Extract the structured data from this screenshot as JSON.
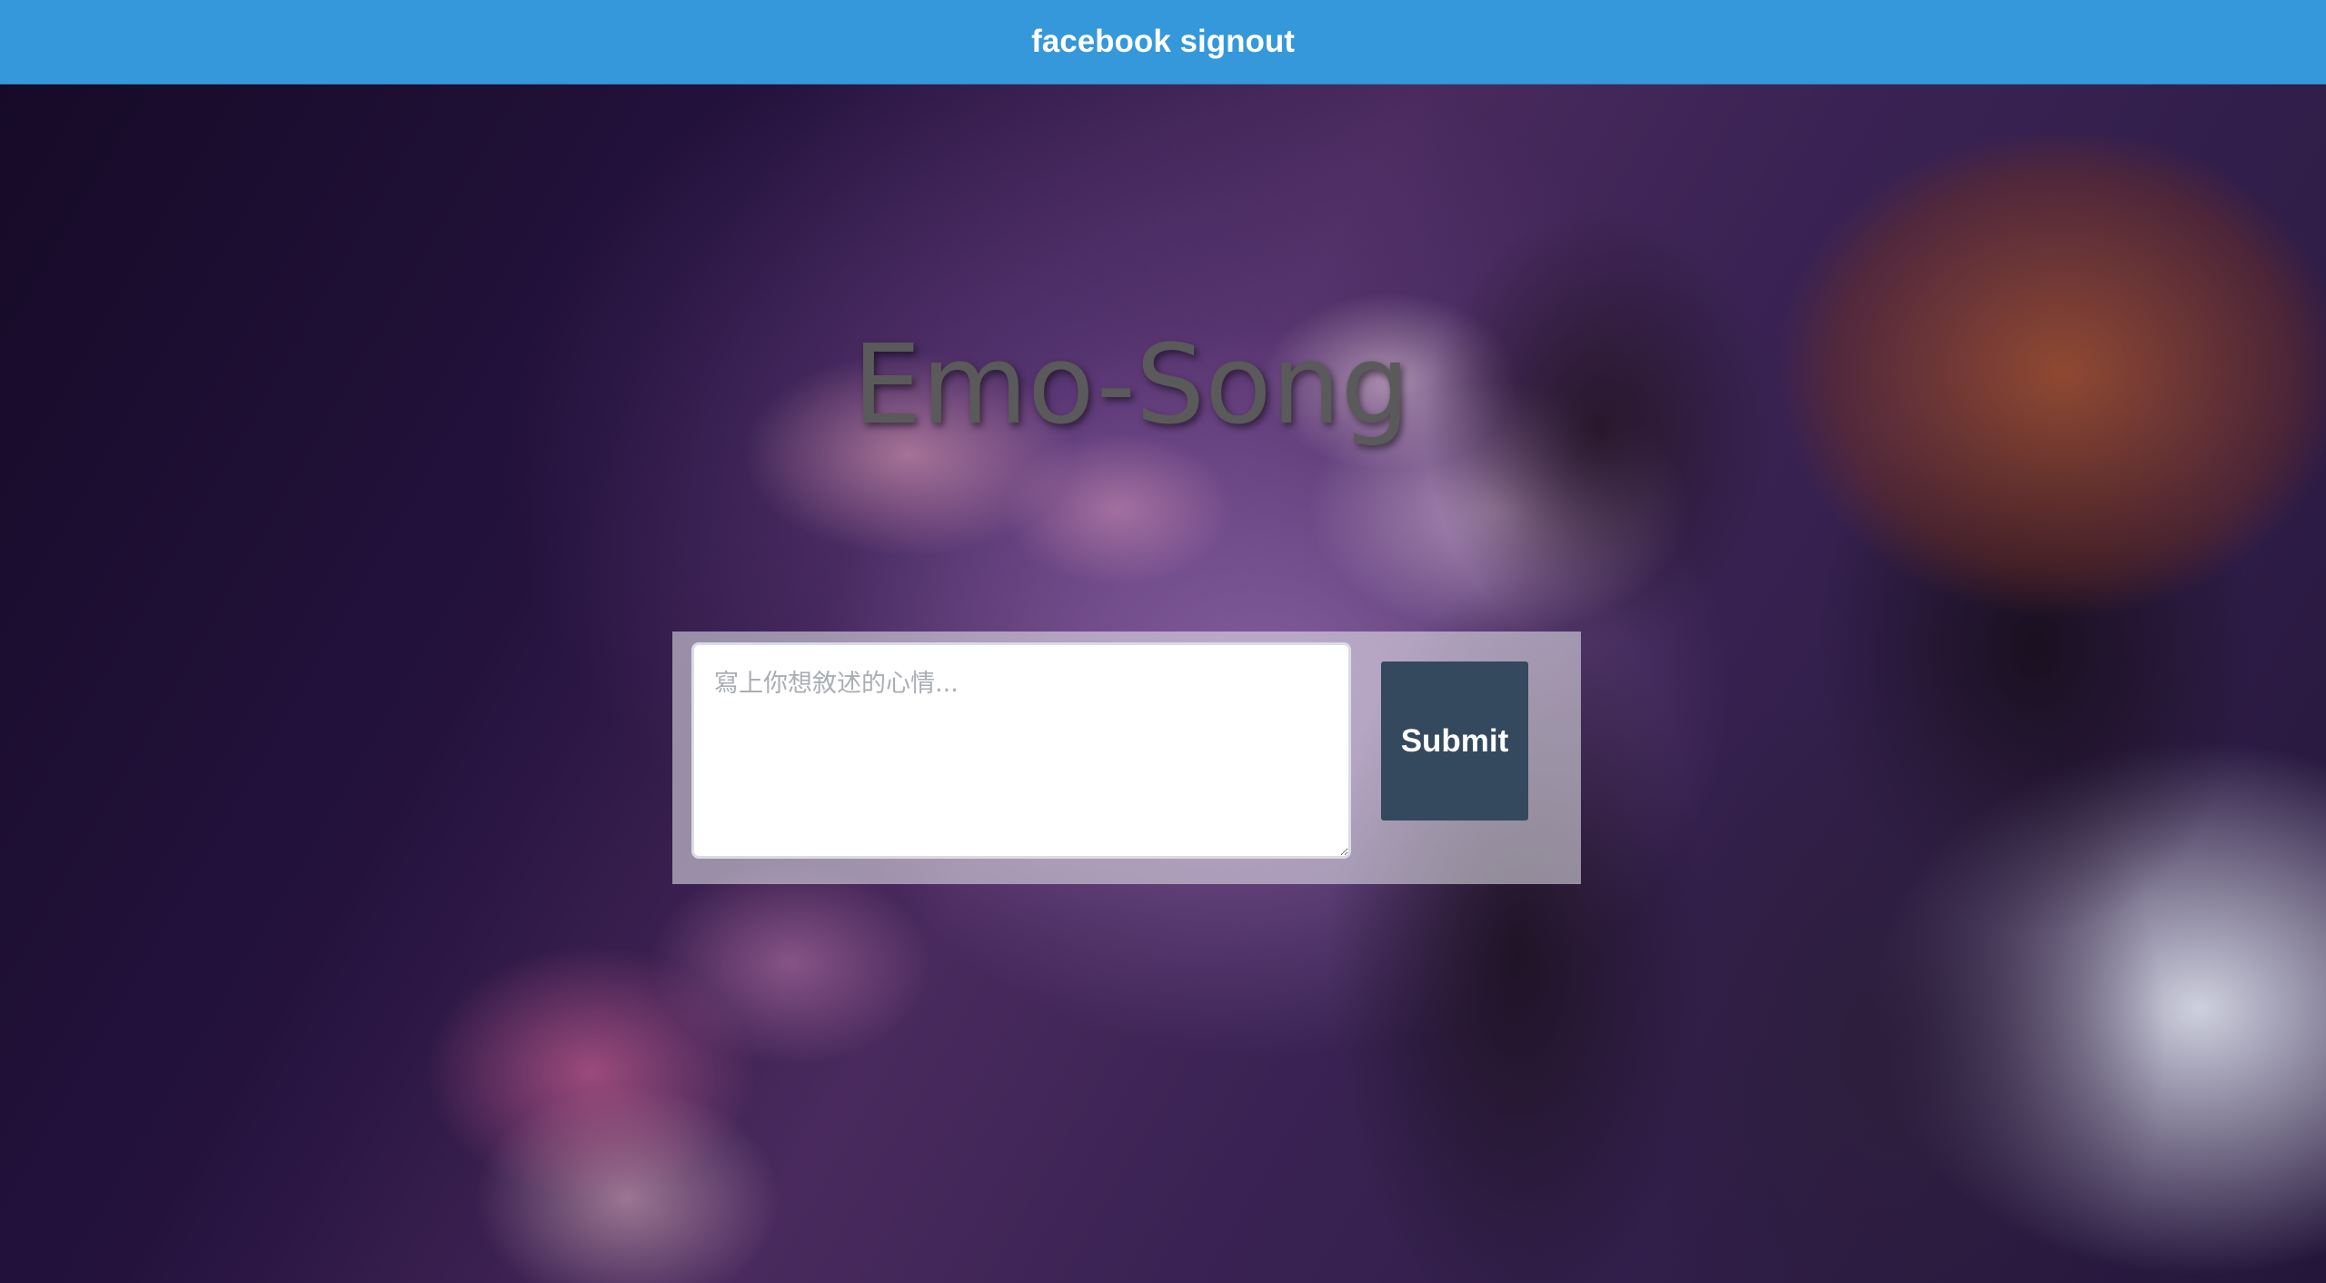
{
  "topbar": {
    "label": "facebook signout",
    "color": "#3498db"
  },
  "header": {
    "title": "Emo-Song"
  },
  "form": {
    "placeholder": "寫上你想敘述的心情...",
    "value": "",
    "submit_label": "Submit",
    "submit_color": "#34495e"
  }
}
